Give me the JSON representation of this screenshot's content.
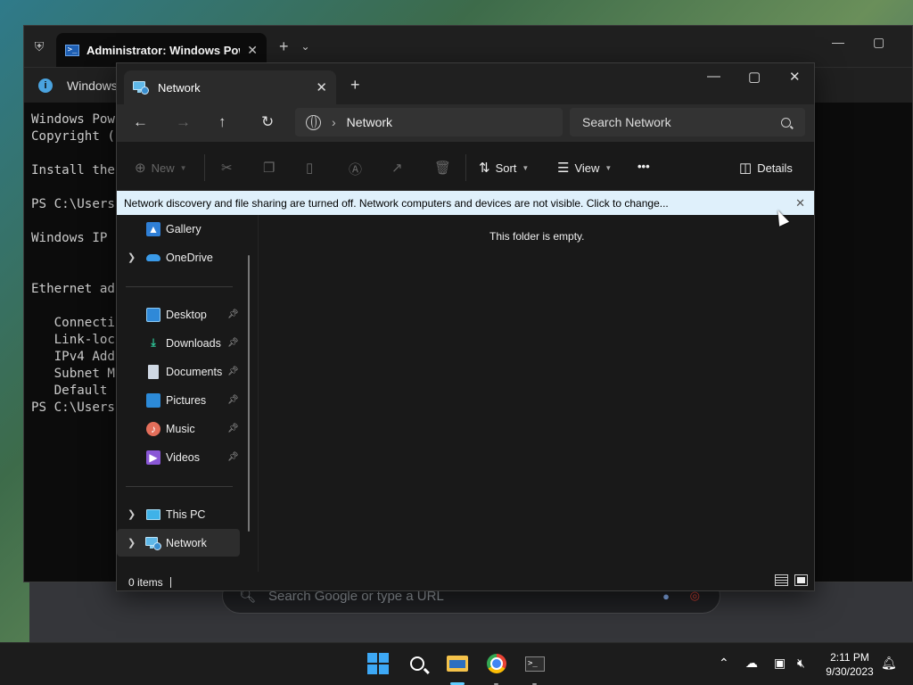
{
  "terminal": {
    "tab_title": "Administrator: Windows Pow",
    "infobar_text": "Windows",
    "lines": [
      "Windows Pow",
      "Copyright (",
      "",
      "Install the",
      "",
      "PS C:\\Users",
      "",
      "Windows IP",
      "",
      "",
      "Ethernet ad",
      "",
      "   Connecti",
      "   Link-loc",
      "   IPv4 Add",
      "   Subnet M",
      "   Default",
      "PS C:\\Users"
    ]
  },
  "chrome": {
    "search_placeholder": "Search Google or type a URL"
  },
  "explorer": {
    "tab_title": "Network",
    "address": {
      "location": "Network"
    },
    "search_placeholder": "Search Network",
    "toolbar": {
      "new_label": "New",
      "sort_label": "Sort",
      "view_label": "View",
      "more_label": "•••",
      "details_label": "Details"
    },
    "banner_text": "Network discovery and file sharing are turned off. Network computers and devices are not visible. Click to change...",
    "sidebar": {
      "items": [
        {
          "label": "Gallery",
          "icon": "gallery-icon"
        },
        {
          "label": "OneDrive",
          "icon": "onedrive-icon"
        },
        {
          "label": "Desktop",
          "icon": "desktop-icon",
          "pinned": true
        },
        {
          "label": "Downloads",
          "icon": "downloads-icon",
          "pinned": true
        },
        {
          "label": "Documents",
          "icon": "documents-icon",
          "pinned": true
        },
        {
          "label": "Pictures",
          "icon": "pictures-icon",
          "pinned": true
        },
        {
          "label": "Music",
          "icon": "music-icon",
          "pinned": true
        },
        {
          "label": "Videos",
          "icon": "videos-icon",
          "pinned": true
        },
        {
          "label": "This PC",
          "icon": "this-pc-icon"
        },
        {
          "label": "Network",
          "icon": "network-icon",
          "selected": true
        }
      ]
    },
    "empty_message": "This folder is empty.",
    "status": {
      "item_count": "0 items"
    }
  },
  "taskbar": {
    "clock_time": "2:11 PM",
    "clock_date": "9/30/2023",
    "accent_color": "#60cdff"
  }
}
